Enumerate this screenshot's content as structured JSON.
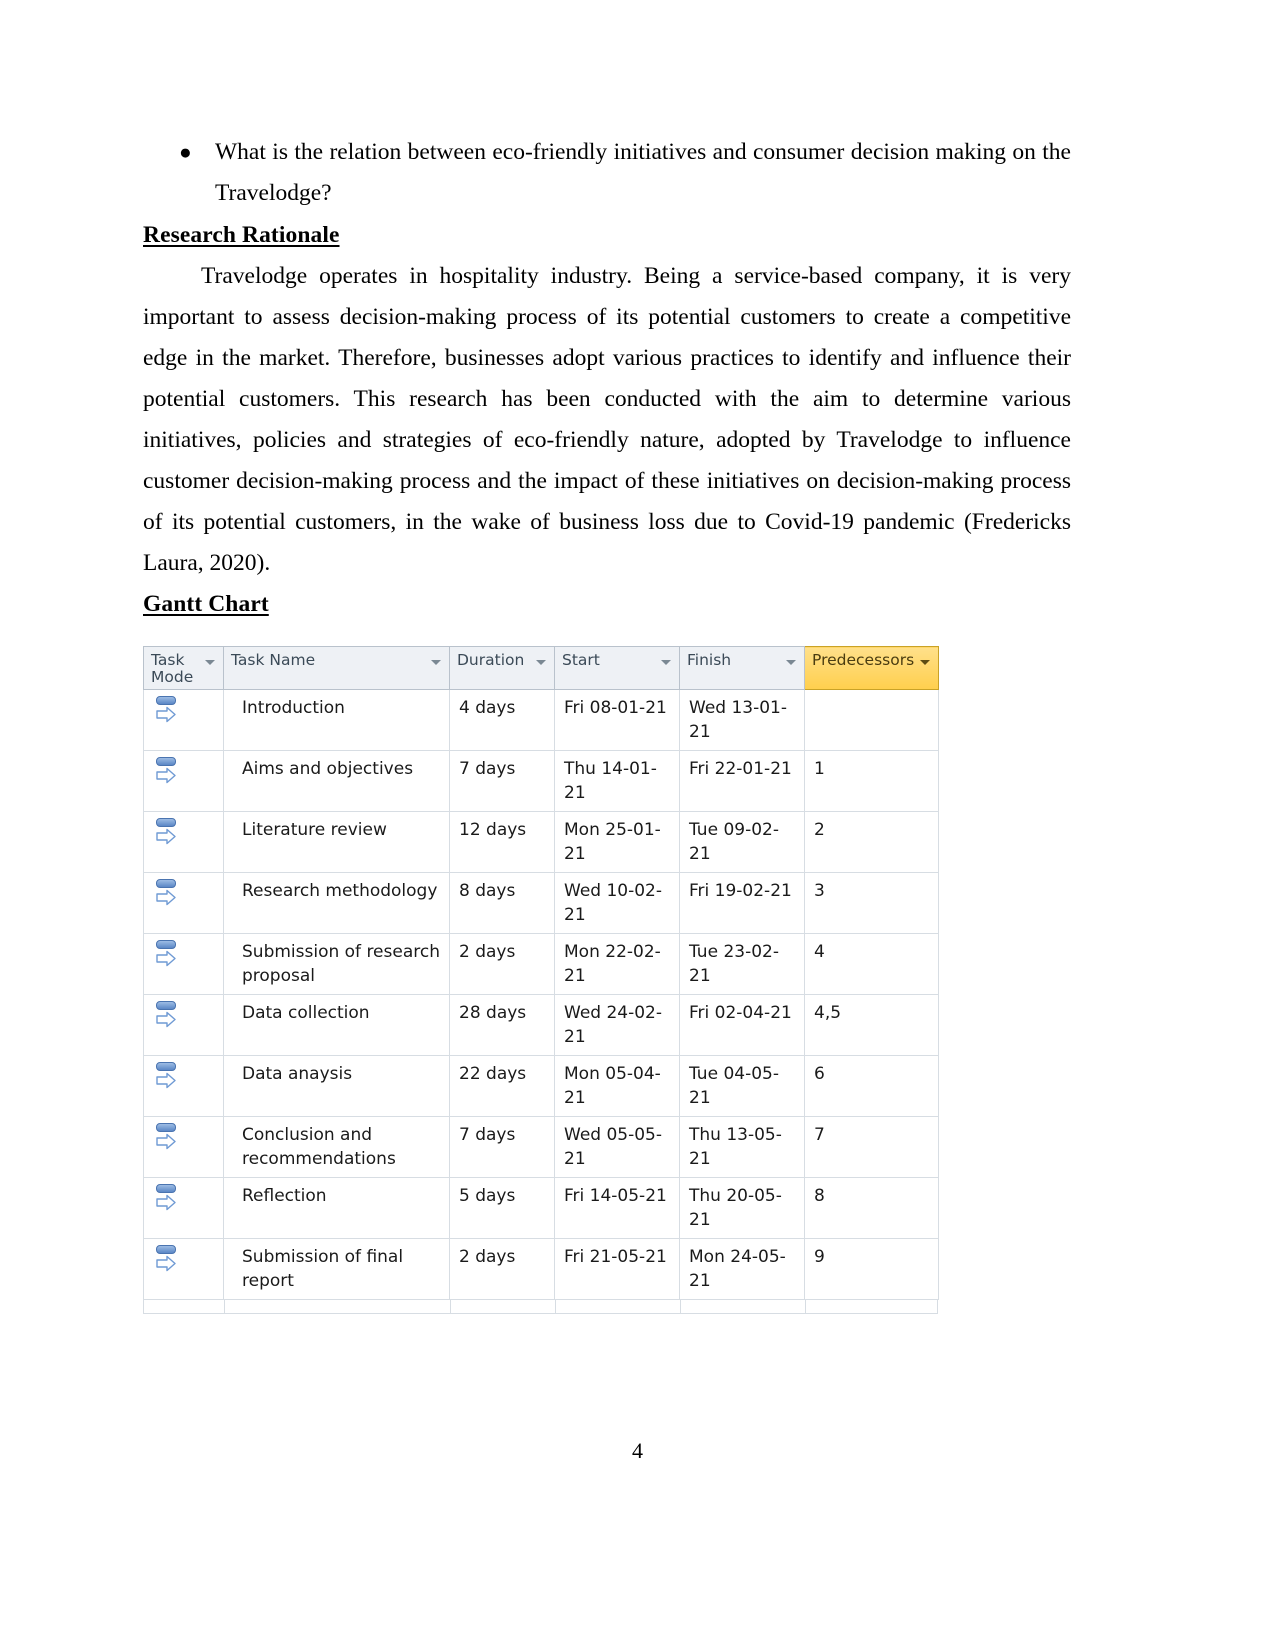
{
  "document": {
    "bullets": [
      "What is the relation between eco-friendly initiatives and consumer decision making on the Travelodge?"
    ],
    "headings": {
      "research_rationale": "Research Rationale",
      "gantt_chart": "Gantt Chart"
    },
    "paragraphs": {
      "rationale": "Travelodge operates in hospitality industry. Being a service-based company, it is very important to assess decision-making process of its potential customers to create a competitive edge in the market. Therefore, businesses adopt various practices to identify and influence their potential customers. This research has been conducted with the aim to determine various initiatives, policies and strategies of eco-friendly nature, adopted by Travelodge to influence customer decision-making process and the impact of these initiatives on decision-making process of its potential customers, in the wake of business loss due to Covid-19 pandemic (Fredericks Laura, 2020)."
    },
    "page_number": "4"
  },
  "gantt": {
    "columns": [
      {
        "key": "task_mode",
        "label": "Task Mode",
        "filter_icon": "chevron-down-icon",
        "highlighted": false
      },
      {
        "key": "task_name",
        "label": "Task Name",
        "filter_icon": "chevron-down-icon",
        "highlighted": false
      },
      {
        "key": "duration",
        "label": "Duration",
        "filter_icon": "chevron-down-icon",
        "highlighted": false
      },
      {
        "key": "start",
        "label": "Start",
        "filter_icon": "chevron-down-icon",
        "highlighted": false
      },
      {
        "key": "finish",
        "label": "Finish",
        "filter_icon": "chevron-down-icon",
        "highlighted": false
      },
      {
        "key": "predecessors",
        "label": "Predecessors",
        "filter_icon": "chevron-down-icon",
        "highlighted": true
      }
    ],
    "header_colors": {
      "default_background": "#eef1f5",
      "highlight_background": "#ffd966",
      "border": "#b9c2cc",
      "text": "#3b4a57"
    },
    "task_mode_icon": "auto-scheduled-icon",
    "rows": [
      {
        "task_mode": "auto-scheduled-icon",
        "task_name": "Introduction",
        "duration": "4 days",
        "start": "Fri 08-01-21",
        "finish": "Wed 13-01-21",
        "predecessors": ""
      },
      {
        "task_mode": "auto-scheduled-icon",
        "task_name": "Aims and objectives",
        "duration": "7 days",
        "start": "Thu 14-01-21",
        "finish": "Fri 22-01-21",
        "predecessors": "1"
      },
      {
        "task_mode": "auto-scheduled-icon",
        "task_name": "Literature review",
        "duration": "12 days",
        "start": "Mon 25-01-21",
        "finish": "Tue 09-02-21",
        "predecessors": "2"
      },
      {
        "task_mode": "auto-scheduled-icon",
        "task_name": "Research methodology",
        "duration": "8 days",
        "start": "Wed 10-02-21",
        "finish": "Fri 19-02-21",
        "predecessors": "3"
      },
      {
        "task_mode": "auto-scheduled-icon",
        "task_name": "Submission of research proposal",
        "duration": "2 days",
        "start": "Mon 22-02-21",
        "finish": "Tue 23-02-21",
        "predecessors": "4"
      },
      {
        "task_mode": "auto-scheduled-icon",
        "task_name": "Data collection",
        "duration": "28 days",
        "start": "Wed 24-02-21",
        "finish": "Fri 02-04-21",
        "predecessors": "4,5"
      },
      {
        "task_mode": "auto-scheduled-icon",
        "task_name": "Data anaysis",
        "duration": "22 days",
        "start": "Mon 05-04-21",
        "finish": "Tue 04-05-21",
        "predecessors": "6"
      },
      {
        "task_mode": "auto-scheduled-icon",
        "task_name": "Conclusion and recommendations",
        "duration": "7 days",
        "start": "Wed 05-05-21",
        "finish": "Thu 13-05-21",
        "predecessors": "7"
      },
      {
        "task_mode": "auto-scheduled-icon",
        "task_name": "Reflection",
        "duration": "5 days",
        "start": "Fri 14-05-21",
        "finish": "Thu 20-05-21",
        "predecessors": "8"
      },
      {
        "task_mode": "auto-scheduled-icon",
        "task_name": "Submission of final report",
        "duration": "2 days",
        "start": "Fri 21-05-21",
        "finish": "Mon 24-05-21",
        "predecessors": "9"
      }
    ]
  }
}
